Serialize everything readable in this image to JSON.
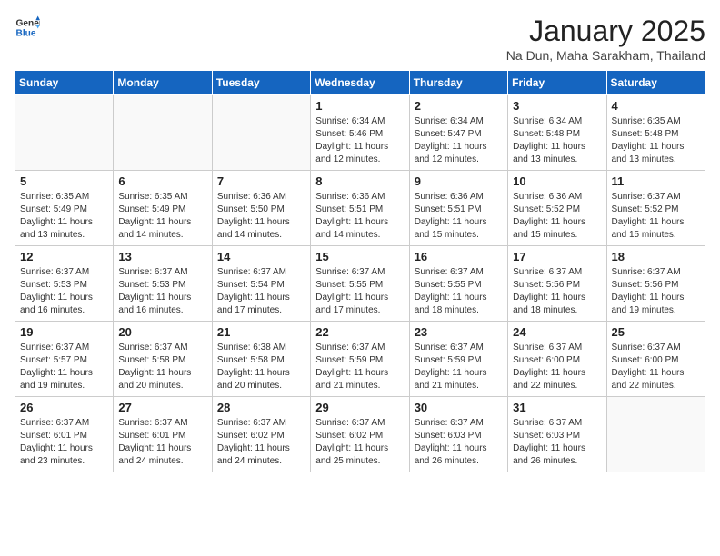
{
  "header": {
    "logo_general": "General",
    "logo_blue": "Blue",
    "title": "January 2025",
    "subtitle": "Na Dun, Maha Sarakham, Thailand"
  },
  "days_of_week": [
    "Sunday",
    "Monday",
    "Tuesday",
    "Wednesday",
    "Thursday",
    "Friday",
    "Saturday"
  ],
  "weeks": [
    [
      {
        "day": "",
        "info": ""
      },
      {
        "day": "",
        "info": ""
      },
      {
        "day": "",
        "info": ""
      },
      {
        "day": "1",
        "info": "Sunrise: 6:34 AM\nSunset: 5:46 PM\nDaylight: 11 hours\nand 12 minutes."
      },
      {
        "day": "2",
        "info": "Sunrise: 6:34 AM\nSunset: 5:47 PM\nDaylight: 11 hours\nand 12 minutes."
      },
      {
        "day": "3",
        "info": "Sunrise: 6:34 AM\nSunset: 5:48 PM\nDaylight: 11 hours\nand 13 minutes."
      },
      {
        "day": "4",
        "info": "Sunrise: 6:35 AM\nSunset: 5:48 PM\nDaylight: 11 hours\nand 13 minutes."
      }
    ],
    [
      {
        "day": "5",
        "info": "Sunrise: 6:35 AM\nSunset: 5:49 PM\nDaylight: 11 hours\nand 13 minutes."
      },
      {
        "day": "6",
        "info": "Sunrise: 6:35 AM\nSunset: 5:49 PM\nDaylight: 11 hours\nand 14 minutes."
      },
      {
        "day": "7",
        "info": "Sunrise: 6:36 AM\nSunset: 5:50 PM\nDaylight: 11 hours\nand 14 minutes."
      },
      {
        "day": "8",
        "info": "Sunrise: 6:36 AM\nSunset: 5:51 PM\nDaylight: 11 hours\nand 14 minutes."
      },
      {
        "day": "9",
        "info": "Sunrise: 6:36 AM\nSunset: 5:51 PM\nDaylight: 11 hours\nand 15 minutes."
      },
      {
        "day": "10",
        "info": "Sunrise: 6:36 AM\nSunset: 5:52 PM\nDaylight: 11 hours\nand 15 minutes."
      },
      {
        "day": "11",
        "info": "Sunrise: 6:37 AM\nSunset: 5:52 PM\nDaylight: 11 hours\nand 15 minutes."
      }
    ],
    [
      {
        "day": "12",
        "info": "Sunrise: 6:37 AM\nSunset: 5:53 PM\nDaylight: 11 hours\nand 16 minutes."
      },
      {
        "day": "13",
        "info": "Sunrise: 6:37 AM\nSunset: 5:53 PM\nDaylight: 11 hours\nand 16 minutes."
      },
      {
        "day": "14",
        "info": "Sunrise: 6:37 AM\nSunset: 5:54 PM\nDaylight: 11 hours\nand 17 minutes."
      },
      {
        "day": "15",
        "info": "Sunrise: 6:37 AM\nSunset: 5:55 PM\nDaylight: 11 hours\nand 17 minutes."
      },
      {
        "day": "16",
        "info": "Sunrise: 6:37 AM\nSunset: 5:55 PM\nDaylight: 11 hours\nand 18 minutes."
      },
      {
        "day": "17",
        "info": "Sunrise: 6:37 AM\nSunset: 5:56 PM\nDaylight: 11 hours\nand 18 minutes."
      },
      {
        "day": "18",
        "info": "Sunrise: 6:37 AM\nSunset: 5:56 PM\nDaylight: 11 hours\nand 19 minutes."
      }
    ],
    [
      {
        "day": "19",
        "info": "Sunrise: 6:37 AM\nSunset: 5:57 PM\nDaylight: 11 hours\nand 19 minutes."
      },
      {
        "day": "20",
        "info": "Sunrise: 6:37 AM\nSunset: 5:58 PM\nDaylight: 11 hours\nand 20 minutes."
      },
      {
        "day": "21",
        "info": "Sunrise: 6:38 AM\nSunset: 5:58 PM\nDaylight: 11 hours\nand 20 minutes."
      },
      {
        "day": "22",
        "info": "Sunrise: 6:37 AM\nSunset: 5:59 PM\nDaylight: 11 hours\nand 21 minutes."
      },
      {
        "day": "23",
        "info": "Sunrise: 6:37 AM\nSunset: 5:59 PM\nDaylight: 11 hours\nand 21 minutes."
      },
      {
        "day": "24",
        "info": "Sunrise: 6:37 AM\nSunset: 6:00 PM\nDaylight: 11 hours\nand 22 minutes."
      },
      {
        "day": "25",
        "info": "Sunrise: 6:37 AM\nSunset: 6:00 PM\nDaylight: 11 hours\nand 22 minutes."
      }
    ],
    [
      {
        "day": "26",
        "info": "Sunrise: 6:37 AM\nSunset: 6:01 PM\nDaylight: 11 hours\nand 23 minutes."
      },
      {
        "day": "27",
        "info": "Sunrise: 6:37 AM\nSunset: 6:01 PM\nDaylight: 11 hours\nand 24 minutes."
      },
      {
        "day": "28",
        "info": "Sunrise: 6:37 AM\nSunset: 6:02 PM\nDaylight: 11 hours\nand 24 minutes."
      },
      {
        "day": "29",
        "info": "Sunrise: 6:37 AM\nSunset: 6:02 PM\nDaylight: 11 hours\nand 25 minutes."
      },
      {
        "day": "30",
        "info": "Sunrise: 6:37 AM\nSunset: 6:03 PM\nDaylight: 11 hours\nand 26 minutes."
      },
      {
        "day": "31",
        "info": "Sunrise: 6:37 AM\nSunset: 6:03 PM\nDaylight: 11 hours\nand 26 minutes."
      },
      {
        "day": "",
        "info": ""
      }
    ]
  ]
}
